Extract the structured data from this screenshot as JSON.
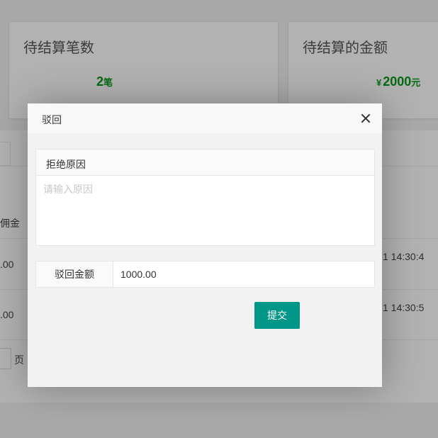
{
  "stats": [
    {
      "title": "待结算笔数",
      "value": "2",
      "unit": "笔"
    },
    {
      "title": "待结算的金额",
      "currency": "¥",
      "value": "2000",
      "unit": "元"
    }
  ],
  "background_table": {
    "column_partial": "佣金",
    "rows": [
      {
        "amount_partial": ".00",
        "time_partial": "1 14:30:4"
      },
      {
        "amount_partial": ".00",
        "time_partial": "1 14:30:5"
      }
    ],
    "pager_suffix": "页"
  },
  "modal": {
    "title": "驳回",
    "close_icon": "close-icon",
    "reason_label": "拒绝原因",
    "reason_placeholder": "请输入原因",
    "reason_value": "",
    "amount_label": "驳回金额",
    "amount_value": "1000.00",
    "submit_label": "提交"
  },
  "colors": {
    "accent": "#009688",
    "stat_value": "#0a9a1a",
    "overlay": "rgba(0,0,0,0.3)"
  }
}
